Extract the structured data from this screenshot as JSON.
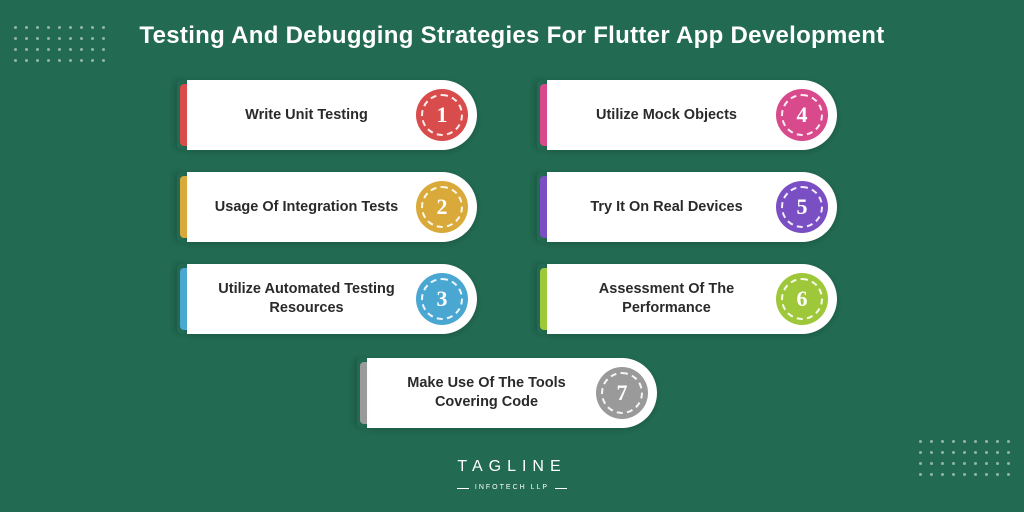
{
  "title": "Testing And Debugging Strategies For Flutter App Development",
  "left": [
    {
      "label": "Write Unit Testing",
      "num": "1",
      "color": "#d94c4c"
    },
    {
      "label": "Usage Of Integration Tests",
      "num": "2",
      "color": "#d9a93a"
    },
    {
      "label": "Utilize Automated Testing Resources",
      "num": "3",
      "color": "#4aa7d1"
    }
  ],
  "right": [
    {
      "label": "Utilize Mock Objects",
      "num": "4",
      "color": "#d84a8b"
    },
    {
      "label": "Try It On Real Devices",
      "num": "5",
      "color": "#7b4fc4"
    },
    {
      "label": "Assessment Of The Performance",
      "num": "6",
      "color": "#9ec73a"
    }
  ],
  "bottom": {
    "label": "Make Use Of The Tools Covering Code",
    "num": "7",
    "color": "#9a9a9a"
  },
  "logo": {
    "main": "TAGLINE",
    "sub": "INFOTECH LLP"
  }
}
